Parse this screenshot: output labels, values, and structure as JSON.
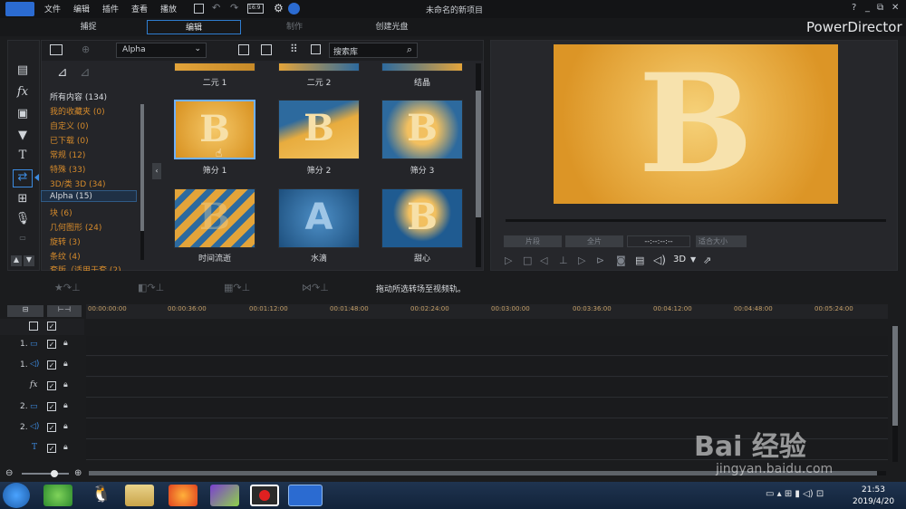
{
  "menu": [
    "文件",
    "编辑",
    "插件",
    "查看",
    "播放"
  ],
  "window_title": "未命名的新项目",
  "window_buttons": [
    "?",
    "_",
    "⧉",
    "✕"
  ],
  "tabs": [
    "捕捉",
    "编辑",
    "制作",
    "创建光盘"
  ],
  "brand": "PowerDirector",
  "library": {
    "dropdown": "Alpha",
    "search_placeholder": "搜索库",
    "categories": [
      "所有内容 (134)",
      "我的收藏夹 (0)",
      "自定义 (0)",
      "已下载 (0)",
      "常规 (12)",
      "特殊 (33)",
      "3D/类 3D (34)",
      "Alpha (15)",
      "块 (6)",
      "几何图形 (24)",
      "旋转 (3)",
      "条纹 (4)",
      "套版（适用于套 (2)"
    ],
    "top_row": [
      "二元 1",
      "二元 2",
      "结晶"
    ],
    "items": [
      {
        "label": "筛分 1",
        "glyph": "B"
      },
      {
        "label": "筛分 2",
        "glyph": "B"
      },
      {
        "label": "筛分 3",
        "glyph": "B"
      },
      {
        "label": "时间流逝",
        "glyph": "B"
      },
      {
        "label": "水滴",
        "glyph": "A"
      },
      {
        "label": "甜心",
        "glyph": "B"
      }
    ]
  },
  "preview": {
    "glyph": "B",
    "btn_clip": "片段",
    "btn_movie": "全片",
    "timecode": "--:--:--:--",
    "fit": "适合大小",
    "mode_3d": "3D"
  },
  "hint": "拖动所选转场至视频轨。",
  "timeline": {
    "ticks": [
      "00:00:00:00",
      "00:00:36:00",
      "00:01:12:00",
      "00:01:48:00",
      "00:02:24:00",
      "00:03:00:00",
      "00:03:36:00",
      "00:04:12:00",
      "00:04:48:00",
      "00:05:24:00"
    ],
    "tracks": [
      "1.",
      "1.",
      "fx",
      "2.",
      "2.",
      "T"
    ]
  },
  "clock": {
    "time": "21:53",
    "date": "2019/4/20"
  },
  "watermark": {
    "logo": "Bai 经验",
    "url": "jingyan.baidu.com"
  },
  "colors": {
    "accent": "#d58a2b",
    "selection": "#2f5a85",
    "brand_blue": "#2b6bd1"
  }
}
